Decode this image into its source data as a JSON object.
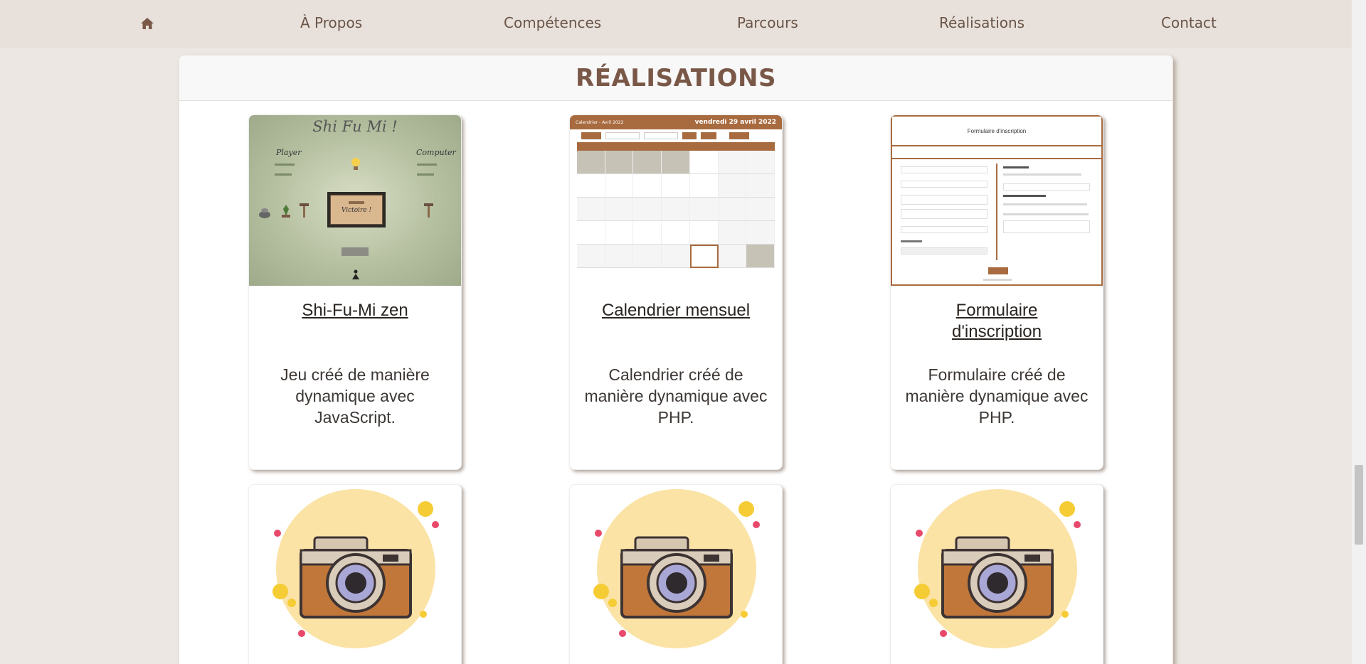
{
  "nav": {
    "home_icon": "home-icon",
    "items": [
      "À Propos",
      "Compétences",
      "Parcours",
      "Réalisations",
      "Contact"
    ]
  },
  "section": {
    "title": "RÉALISATIONS"
  },
  "projects": [
    {
      "title": "Shi-Fu-Mi zen",
      "description": "Jeu créé de manière dynamique avec JavaScript.",
      "thumb": {
        "title": "Shi Fu Mi !",
        "player": "Player",
        "computer": "Computer",
        "victory": "Victoire !"
      }
    },
    {
      "title": "Calendrier mensuel",
      "description": "Calendrier créé de manière dynamique avec PHP.",
      "thumb": {
        "header_left": "Calendrier - Avril 2022",
        "header_right": "vendredi 29 avril 2022"
      }
    },
    {
      "title": "Formulaire d'inscription",
      "description": "Formulaire créé de manière dynamique avec PHP.",
      "thumb": {
        "header": "Formulaire d'inscription"
      }
    }
  ],
  "placeholder_icon": "camera-icon",
  "colors": {
    "accent": "#a86b3f",
    "title": "#7a5848",
    "nav_bg": "#e8e1db",
    "page_bg": "#ece7e2"
  }
}
